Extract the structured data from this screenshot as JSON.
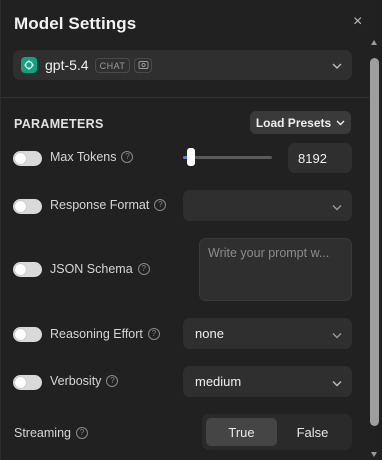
{
  "header": {
    "title": "Model Settings",
    "close_glyph": "×"
  },
  "model": {
    "name": "gpt-5.4",
    "badge": "CHAT",
    "logo_icon": "openai-logo-icon",
    "badge_icon": "vision-icon"
  },
  "parameters": {
    "section_label": "PARAMETERS",
    "load_presets_label": "Load Presets",
    "max_tokens": {
      "label": "Max Tokens",
      "value": "8192",
      "slider_fraction": 0.08,
      "enabled": false
    },
    "response_format": {
      "label": "Response Format",
      "value": "",
      "enabled": false
    },
    "json_schema": {
      "label": "JSON Schema",
      "placeholder": "Write your prompt w...",
      "enabled": false
    },
    "reasoning_effort": {
      "label": "Reasoning Effort",
      "value": "none",
      "enabled": false
    },
    "verbosity": {
      "label": "Verbosity",
      "value": "medium",
      "enabled": false
    },
    "streaming": {
      "label": "Streaming",
      "options": [
        "True",
        "False"
      ],
      "selected": "True"
    }
  },
  "colors": {
    "accent": "#4f7cf0",
    "openai_green": "#10a37f",
    "panel_bg": "#212121",
    "field_bg": "#2f2f2f"
  }
}
